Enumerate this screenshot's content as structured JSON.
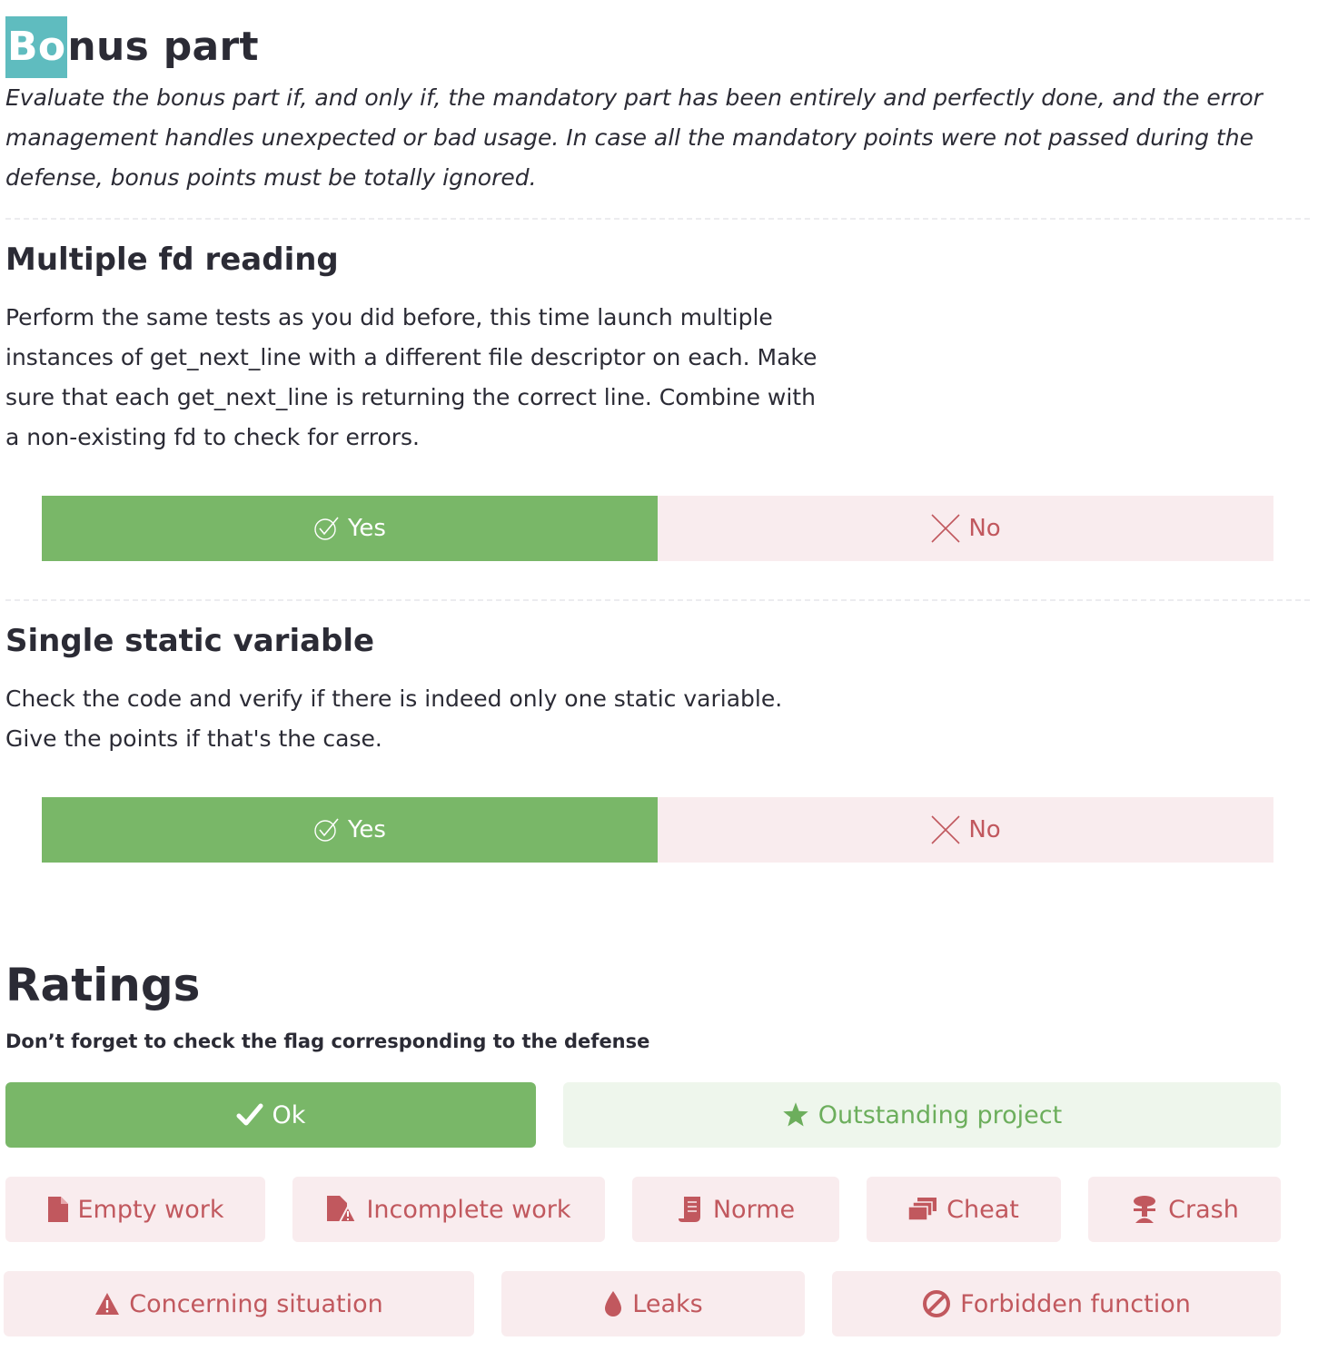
{
  "bonus": {
    "title_highlight": "Bo",
    "title_rest": "nus part",
    "description": "Evaluate the bonus part if, and only if, the mandatory part has been entirely and perfectly done, and the error management handles unexpected or bad usage. In case all the mandatory points were not passed during the defense, bonus points must be totally ignored."
  },
  "sections": [
    {
      "title": "Multiple fd reading",
      "description": "Perform the same tests as you did before, this time launch multiple instances of get_next_line with a different file descriptor on each. Make sure that each get_next_line is returning the correct line. Combine with a non-existing fd to check for errors.",
      "yes_label": "Yes",
      "no_label": "No",
      "selected": "yes"
    },
    {
      "title": "Single static variable",
      "description": "Check the code and verify if there is indeed only one static variable. Give the points if that's the case.",
      "yes_label": "Yes",
      "no_label": "No",
      "selected": "yes"
    }
  ],
  "ratings": {
    "title": "Ratings",
    "subtitle": "Don’t forget to check the flag corresponding to the defense",
    "flags": [
      {
        "label": "Ok",
        "icon": "check-icon",
        "selected": true
      },
      {
        "label": "Outstanding project",
        "icon": "star-icon"
      },
      {
        "label": "Empty work",
        "icon": "file-icon"
      },
      {
        "label": "Incomplete work",
        "icon": "file-warning-icon"
      },
      {
        "label": "Norme",
        "icon": "scroll-icon"
      },
      {
        "label": "Cheat",
        "icon": "copy-icon"
      },
      {
        "label": "Crash",
        "icon": "explosion-icon"
      },
      {
        "label": "Concerning situation",
        "icon": "warning-icon"
      },
      {
        "label": "Leaks",
        "icon": "drop-icon"
      },
      {
        "label": "Forbidden function",
        "icon": "ban-icon"
      }
    ]
  },
  "colors": {
    "accent_green": "#79b768",
    "bad_red": "#c1585e",
    "bad_bg": "#f9ecee",
    "highlight_teal": "#5fbcbf"
  }
}
